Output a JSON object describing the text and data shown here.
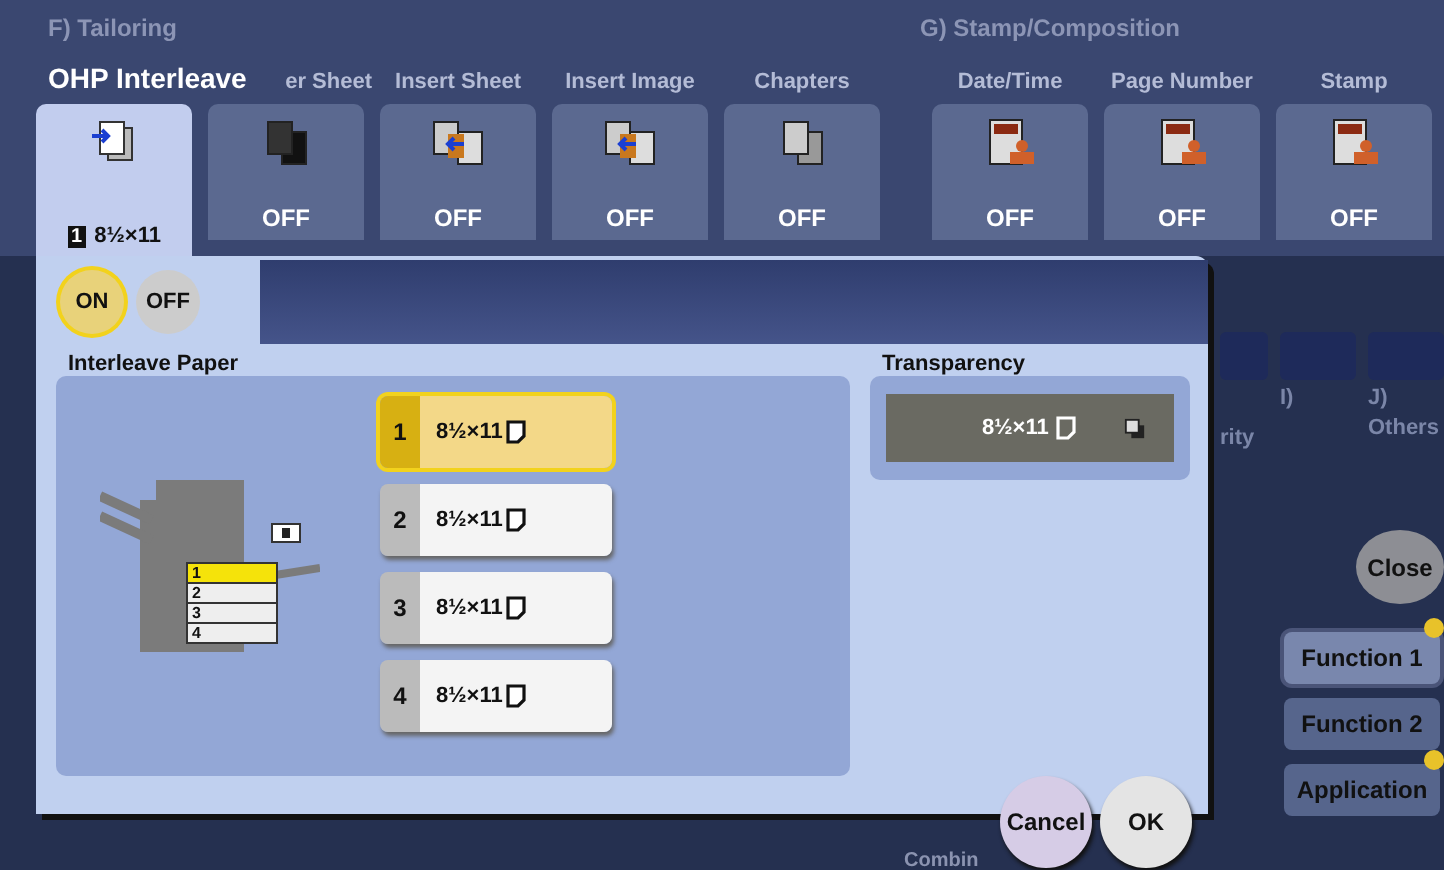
{
  "sections": [
    {
      "label": "F)  Tailoring"
    },
    {
      "label": "G)  Stamp/Composition"
    }
  ],
  "tiles": [
    {
      "label": "OHP Interleave",
      "kind": "interleave",
      "tray": "1",
      "value": "8½×11",
      "selected": true
    },
    {
      "label": "er Sheet",
      "kind": "cover",
      "value": "OFF",
      "selected": false
    },
    {
      "label": "Insert Sheet",
      "kind": "insert-sheet",
      "value": "OFF",
      "selected": false
    },
    {
      "label": "Insert Image",
      "kind": "insert-image",
      "value": "OFF",
      "selected": false
    },
    {
      "label": "Chapters",
      "kind": "chapters",
      "value": "OFF",
      "selected": false
    },
    {
      "label": "Date/Time",
      "kind": "date-time",
      "value": "OFF",
      "selected": false
    },
    {
      "label": "Page Number",
      "kind": "page-number",
      "value": "OFF",
      "selected": false
    },
    {
      "label": "Stamp",
      "kind": "stamp",
      "value": "OFF",
      "selected": false
    }
  ],
  "right_group": {
    "cut_label": "rity",
    "items": [
      {
        "label": "I)"
      },
      {
        "label": "J)",
        "sub": "Others"
      }
    ]
  },
  "close": "Close",
  "side_tabs": [
    {
      "label": "Function 1",
      "selected": true,
      "dot": true
    },
    {
      "label": "Function 2",
      "selected": false,
      "dot": false
    },
    {
      "label": "Application",
      "selected": false,
      "dot": true
    }
  ],
  "bottom_label": "Combin",
  "dialog": {
    "toggle": [
      {
        "label": "ON",
        "selected": true
      },
      {
        "label": "OFF",
        "selected": false
      }
    ],
    "paper_title": "Interleave Paper",
    "trays": [
      {
        "number": "1",
        "size": "8½×11",
        "selected": true
      },
      {
        "number": "2",
        "size": "8½×11",
        "selected": false
      },
      {
        "number": "3",
        "size": "8½×11",
        "selected": false
      },
      {
        "number": "4",
        "size": "8½×11",
        "selected": false
      }
    ],
    "machine_trays": [
      {
        "label": "1",
        "selected": true
      },
      {
        "label": "2",
        "selected": false
      },
      {
        "label": "3",
        "selected": false
      },
      {
        "label": "4",
        "selected": false
      }
    ],
    "transparency": {
      "title": "Transparency",
      "size": "8½×11"
    },
    "buttons": [
      {
        "label": "Cancel",
        "kind": "cancel"
      },
      {
        "label": "OK",
        "kind": "ok"
      }
    ]
  }
}
